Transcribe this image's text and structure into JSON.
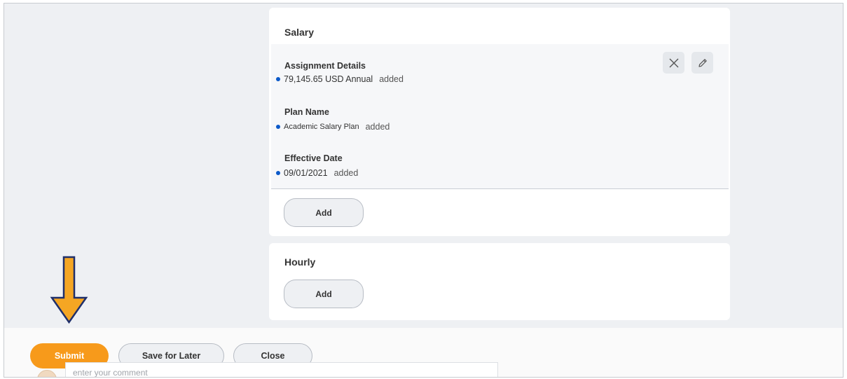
{
  "salary": {
    "title": "Salary",
    "fields": [
      {
        "label": "Assignment Details",
        "value": "79,145.65 USD Annual",
        "status": "added"
      },
      {
        "label": "Plan Name",
        "value": "Academic Salary Plan",
        "status": "added"
      },
      {
        "label": "Effective Date",
        "value": "09/01/2021",
        "status": "added"
      }
    ],
    "add_label": "Add"
  },
  "hourly": {
    "title": "Hourly",
    "add_label": "Add"
  },
  "footer": {
    "submit_label": "Submit",
    "save_later_label": "Save for Later",
    "close_label": "Close",
    "comment_placeholder": "enter your comment"
  },
  "icons": {
    "remove": "close-icon",
    "edit": "pencil-icon",
    "annotation": "arrow-down-icon"
  },
  "colors": {
    "accent": "#f79a1b",
    "added_dot": "#0b59c9",
    "annotation_arrow": "#f5a623"
  }
}
